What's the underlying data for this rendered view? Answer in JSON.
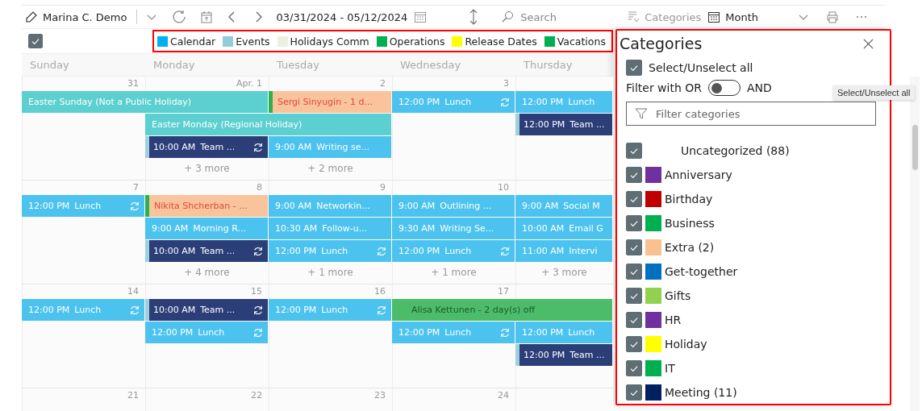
{
  "toolbar": {
    "user": "Marina C. Demo",
    "date_range": "03/31/2024 - 05/12/2024",
    "search": {
      "placeholder": "Search"
    },
    "categories_button": {
      "label": "Categories",
      "disabled": true
    },
    "view": "Month"
  },
  "legend": {
    "checked": true,
    "items": [
      {
        "label": "Calendar",
        "color": "#00b0f0"
      },
      {
        "label": "Events",
        "color": "#92cddc"
      },
      {
        "label": "Holidays Comm",
        "color": "#ebf1de"
      },
      {
        "label": "Operations",
        "color": "#00b050"
      },
      {
        "label": "Release Dates",
        "color": "#ffff00"
      },
      {
        "label": "Vacations",
        "color": "#00b050"
      }
    ]
  },
  "calendar": {
    "weekdays": [
      "Sunday",
      "Monday",
      "Tuesday",
      "Wednesday",
      "Thursday"
    ],
    "weeks": [
      {
        "days": [
          {
            "number": "31"
          },
          {
            "number": "Apr. 1",
            "more": "+ 3 more"
          },
          {
            "number": "2",
            "more": "+ 2 more"
          },
          {
            "number": "3"
          }
        ],
        "lanes": [
          [
            {
              "kind": "holiday",
              "title": "Easter Sunday (Not a Public Holiday)",
              "wide": true
            },
            {
              "kind": "extra",
              "title": "Sergi Sinyugin - 1 d..."
            },
            {
              "kind": "appointment",
              "time": "12:00 PM",
              "title": "Lunch",
              "recurring": true
            },
            {
              "kind": "appointment",
              "time": "12:00 PM",
              "title": "Lunch"
            }
          ],
          [
            {
              "kind": "gap"
            },
            {
              "kind": "holiday",
              "title": "Easter Monday (Regional Holiday)",
              "wide": true
            },
            {
              "kind": "gap"
            },
            {
              "kind": "team",
              "time": "12:00 PM",
              "title": "Team ..."
            }
          ],
          [
            {
              "kind": "gap"
            },
            {
              "kind": "team",
              "time": "10:00 AM",
              "title": "Team ...",
              "recurring": true
            },
            {
              "kind": "appointment",
              "time": "9:00 AM",
              "title": "Writing se..."
            },
            {
              "kind": "gap"
            },
            {
              "kind": "gap"
            }
          ]
        ]
      },
      {
        "days": [
          {
            "number": "7"
          },
          {
            "number": "8",
            "more": "+ 4 more"
          },
          {
            "number": "9",
            "more": "+ 1 more"
          },
          {
            "number": "10",
            "more": "+ 1 more"
          },
          {
            "more": "+ 3 more"
          }
        ],
        "lanes": [
          [
            {
              "kind": "appointment",
              "time": "12:00 PM",
              "title": "Lunch",
              "recurring": true
            },
            {
              "kind": "extra",
              "title": "Nikita Shcherban - ..."
            },
            {
              "kind": "appointment",
              "time": "9:00 AM",
              "title": "Networkin..."
            },
            {
              "kind": "appointment",
              "time": "9:00 AM",
              "title": "Outlining ..."
            },
            {
              "kind": "appointment",
              "time": "9:00 AM",
              "title": "Social M"
            }
          ],
          [
            {
              "kind": "gap"
            },
            {
              "kind": "appointment",
              "time": "9:00 AM",
              "title": "Morning R..."
            },
            {
              "kind": "appointment",
              "time": "10:30 AM",
              "title": "Follow-u..."
            },
            {
              "kind": "appointment",
              "time": "9:30 AM",
              "title": "Writing Se..."
            },
            {
              "kind": "appointment",
              "time": "10:00 AM",
              "title": "Email G"
            }
          ],
          [
            {
              "kind": "gap"
            },
            {
              "kind": "team",
              "time": "10:00 AM",
              "title": "Team ...",
              "recurring": true
            },
            {
              "kind": "appointment",
              "time": "12:00 PM",
              "title": "Lunch",
              "recurring": true
            },
            {
              "kind": "appointment",
              "time": "12:00 PM",
              "title": "Lunch",
              "recurring": true
            },
            {
              "kind": "appointment",
              "time": "11:00 AM",
              "title": "Intervi"
            }
          ]
        ]
      },
      {
        "days": [
          {
            "number": "14"
          },
          {
            "number": "15"
          },
          {
            "number": "16"
          },
          {
            "number": "17"
          }
        ],
        "lanes": [
          [
            {
              "kind": "appointment",
              "time": "12:00 PM",
              "title": "Lunch",
              "recurring": true
            },
            {
              "kind": "team",
              "time": "10:00 AM",
              "title": "Team ...",
              "recurring": true
            },
            {
              "kind": "appointment",
              "time": "12:00 PM",
              "title": "Lunch",
              "recurring": true
            },
            {
              "kind": "off",
              "title": "Alisa Kettunen - 2 day(s) off",
              "wide": true
            }
          ],
          [
            {
              "kind": "gap"
            },
            {
              "kind": "appointment",
              "time": "12:00 PM",
              "title": "Lunch",
              "recurring": true
            },
            {
              "kind": "gap"
            },
            {
              "kind": "appointment",
              "time": "12:00 PM",
              "title": "Lunch",
              "recurring": true
            },
            {
              "kind": "appointment",
              "time": "12:00 PM",
              "title": "Lunch"
            }
          ],
          [
            {
              "kind": "gap"
            },
            {
              "kind": "gap"
            },
            {
              "kind": "gap"
            },
            {
              "kind": "gap"
            },
            {
              "kind": "team",
              "time": "12:00 PM",
              "title": "Team ..."
            }
          ]
        ]
      },
      {
        "days": [
          {
            "number": "21"
          },
          {
            "number": "22"
          },
          {
            "number": "23"
          },
          {
            "number": "24"
          }
        ]
      }
    ]
  },
  "panel": {
    "title": "Categories",
    "select_all": {
      "label": "Select/Unselect all",
      "checked": true
    },
    "filter_toggle": {
      "label_left": "Filter with OR",
      "label_right": "AND",
      "on": false
    },
    "filter": {
      "placeholder": "Filter categories"
    },
    "categories": [
      {
        "label": "Uncategorized (88)",
        "checked": true
      },
      {
        "label": "Anniversary",
        "color": "#7030a0",
        "checked": true
      },
      {
        "label": "Birthday",
        "color": "#c00000",
        "checked": true
      },
      {
        "label": "Business",
        "color": "#00b050",
        "checked": true
      },
      {
        "label": "Extra (2)",
        "color": "#fac090",
        "checked": true
      },
      {
        "label": "Get-together",
        "color": "#0070c0",
        "checked": true
      },
      {
        "label": "Gifts",
        "color": "#92d050",
        "checked": true
      },
      {
        "label": "HR",
        "color": "#7030a0",
        "checked": true
      },
      {
        "label": "Holiday",
        "color": "#ffff00",
        "checked": true
      },
      {
        "label": "IT",
        "color": "#00b050",
        "checked": true
      },
      {
        "label": "Meeting (11)",
        "color": "#002060",
        "checked": true
      }
    ]
  },
  "tooltip": "Select/Unselect all"
}
